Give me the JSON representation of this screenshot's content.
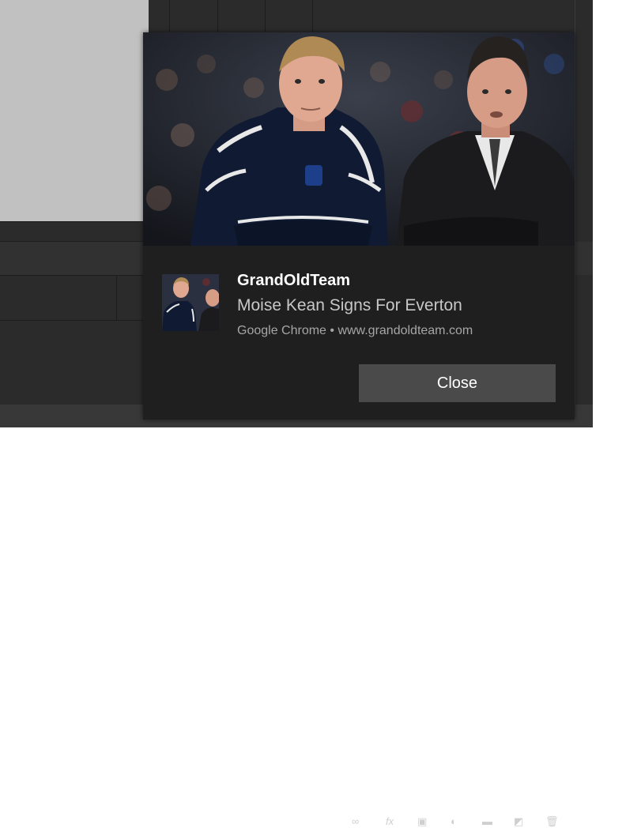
{
  "background_app": {
    "toolbar_icons": [
      "function-icon",
      "grid-icon",
      "chart-icon",
      "table-icon",
      "image-icon",
      "trash-icon"
    ],
    "function_glyph": "fx"
  },
  "toast": {
    "hero_image": "photo of two football managers in dark coats in front of a crowd",
    "thumbnail_image": "small thumbnail of the same photo",
    "title": "GrandOldTeam",
    "message": "Moise Kean Signs For Everton",
    "attribution": "Google Chrome • www.grandoldteam.com",
    "close_label": "Close"
  },
  "colors": {
    "toast_background": "#1f1f1f",
    "button_background": "#4a4a4a",
    "app_background": "#2b2b2b",
    "panel_gray": "#c1c1c1"
  }
}
